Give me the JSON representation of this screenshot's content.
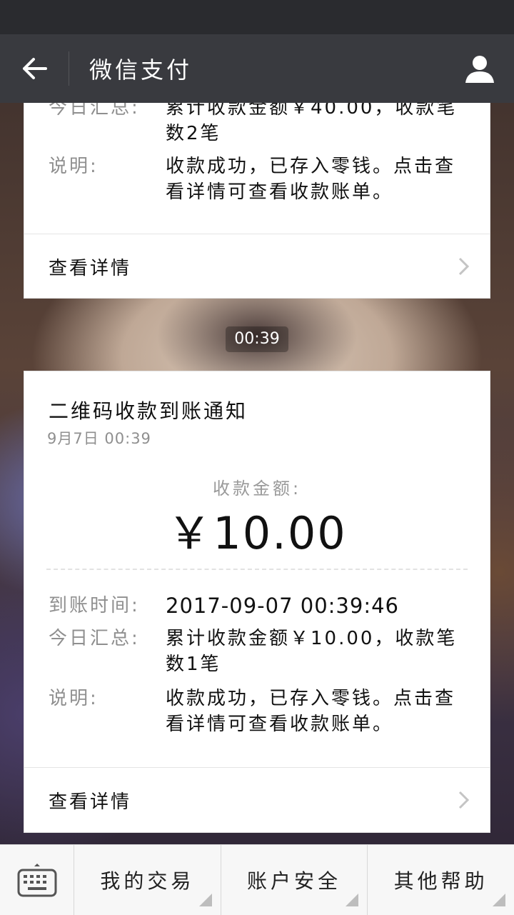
{
  "navbar": {
    "title": "微信支付",
    "back_icon": "arrow-left-icon",
    "profile_icon": "person-icon"
  },
  "card_prev": {
    "summary_label": "今日汇总:",
    "summary_value": "累计收款金额￥40.00，收款笔数2笔",
    "note_label": "说明:",
    "note_value": "收款成功，已存入零钱。点击查看详情可查看收款账单。",
    "link_label": "查看详情"
  },
  "time_separator": "00:39",
  "card_main": {
    "title": "二维码收款到账通知",
    "date": "9月7日  00:39",
    "amount_label": "收款金额:",
    "amount": "￥10.00",
    "arrival_label": "到账时间:",
    "arrival_value": "2017-09-07 00:39:46",
    "summary_label": "今日汇总:",
    "summary_value": "累计收款金额￥10.00，收款笔数1笔",
    "note_label": "说明:",
    "note_value": "收款成功，已存入零钱。点击查看详情可查看收款账单。",
    "link_label": "查看详情"
  },
  "bottom_menu": {
    "keyboard_icon": "keyboard-icon",
    "items": [
      "我的交易",
      "账户安全",
      "其他帮助"
    ]
  },
  "colors": {
    "navbar": "#393a3f",
    "statusbar": "#2a2b2f",
    "label_gray": "#8f8f8f"
  }
}
